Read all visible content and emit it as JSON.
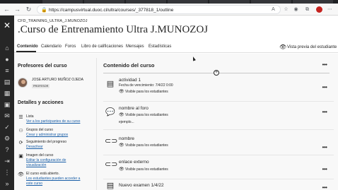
{
  "browser": {
    "url": "https://campusvirtual.duoc.cl/ultra/courses/_377818_1/outline",
    "back_icon": "back-arrow-icon",
    "forward_icon": "forward-arrow-icon",
    "refresh_icon": "refresh-icon",
    "lock_icon": "lock-icon"
  },
  "course": {
    "code": "CFD_TRAINING_ULTRA_J.MUNOZOJ",
    "title": ".Curso de Entrenamiento Ultra J.MUNOZOJ"
  },
  "tabs": [
    {
      "label": "Contenido",
      "active": true
    },
    {
      "label": "Calendario",
      "active": false
    },
    {
      "label": "Foros",
      "active": false
    },
    {
      "label": "Libro de calificaciones",
      "active": false
    },
    {
      "label": "Mensajes",
      "active": false
    },
    {
      "label": "Estadísticas",
      "active": false
    }
  ],
  "preview_label": "Vista previa del estudiante",
  "left_panel": {
    "teachers_heading": "Profesores del curso",
    "teacher_name": "JOSE ARTURO MUÑOZ OJEDA",
    "teacher_role": "PROFESOR",
    "details_heading": "Detalles y acciones",
    "details": [
      {
        "icon": "list-icon",
        "title": "Lista",
        "link": "Ver a los participantes de su curso",
        "link2": ""
      },
      {
        "icon": "groups-icon",
        "title": "Grupos del curso",
        "link": "Crear y administrar grupos",
        "link2": ""
      },
      {
        "icon": "progress-icon",
        "title": "Seguimiento del progreso",
        "link": "Desactivar",
        "link2": ""
      },
      {
        "icon": "image-icon",
        "title": "Imagen del curso",
        "link": "Editar la configuración de",
        "link2": "visualización"
      },
      {
        "icon": "eye-icon",
        "title": "El curso está abierto.",
        "link": "Los estudiantes pueden acceder a",
        "link2": "este curso"
      }
    ]
  },
  "content": {
    "heading": "Contenido del curso",
    "items": [
      {
        "icon": "assignment-icon",
        "title": "actividad 1",
        "subtitle": "Fecha de vencimiento: 7/4/22 0:00",
        "visibility": "Visible para los estudiantes",
        "description": ""
      },
      {
        "icon": "forum-icon",
        "title": "nombre al foro",
        "subtitle": "",
        "visibility": "Visible para los estudiantes",
        "description": "ejemplo..."
      },
      {
        "icon": "link-icon",
        "title": "nombre",
        "subtitle": "",
        "visibility": "Visible para los estudiantes",
        "description": ""
      },
      {
        "icon": "link-icon",
        "title": "enlace externo",
        "subtitle": "",
        "visibility": "Visible para los estudiantes",
        "description": ""
      },
      {
        "icon": "test-icon",
        "title": "Nuevo examen 1/4/22",
        "subtitle": "",
        "visibility": "",
        "description": ""
      }
    ]
  }
}
